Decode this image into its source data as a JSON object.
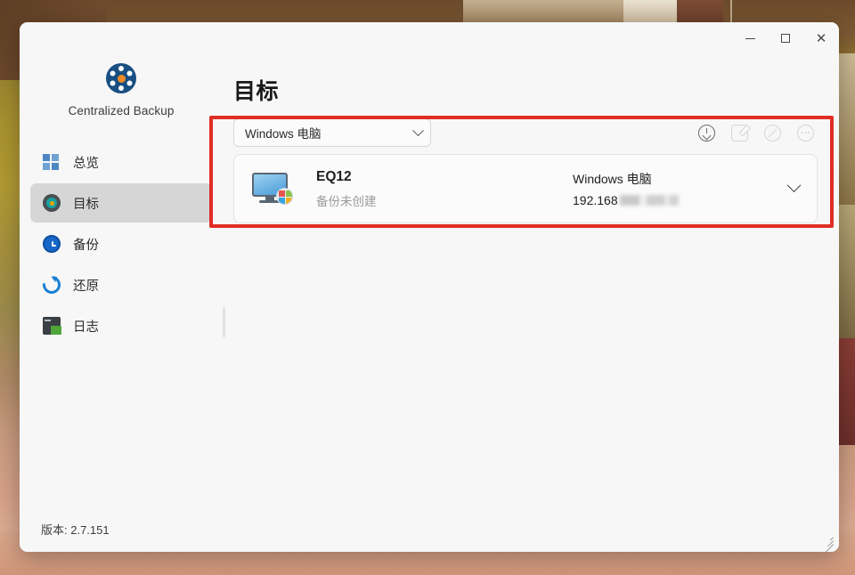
{
  "wallpaper": {
    "top_color": "#a8922f",
    "bottom_color": "#d5a188"
  },
  "window": {
    "controls": {
      "minimize_label": "–",
      "maximize_label": "□",
      "close_label": "✕"
    }
  },
  "sidebar": {
    "brand": {
      "name": "Centralized Backup",
      "logo_icon": "hub-network-icon",
      "accent": "#194f82",
      "hub_color": "#f08a24"
    },
    "items": [
      {
        "label": "总览",
        "icon": "grid-overview-icon",
        "active": false
      },
      {
        "label": "目标",
        "icon": "target-icon",
        "active": true
      },
      {
        "label": "备份",
        "icon": "clock-backup-icon",
        "active": false
      },
      {
        "label": "还原",
        "icon": "refresh-restore-icon",
        "active": false
      },
      {
        "label": "日志",
        "icon": "document-log-icon",
        "active": false
      }
    ],
    "version": "版本: 2.7.151"
  },
  "main": {
    "title": "目标",
    "filter": {
      "selected": "Windows 电脑",
      "chevron_icon": "chevron-down-icon",
      "options": [
        "Windows 电脑"
      ]
    },
    "toolbar": [
      {
        "name": "download-icon",
        "label": "下载",
        "enabled": true
      },
      {
        "name": "edit-icon",
        "label": "编辑",
        "enabled": false
      },
      {
        "name": "block-icon",
        "label": "禁用",
        "enabled": false
      },
      {
        "name": "more-icon",
        "label": "更多",
        "enabled": false
      }
    ],
    "devices": [
      {
        "icon": "windows-computer-icon",
        "name": "EQ12",
        "status": "备份未创建",
        "type": "Windows 电脑",
        "ip": "192.168",
        "ip_masked": true,
        "expand_icon": "chevron-down-icon"
      }
    ]
  },
  "annotation": {
    "color": "#e02e25",
    "shape": "rectangle"
  }
}
